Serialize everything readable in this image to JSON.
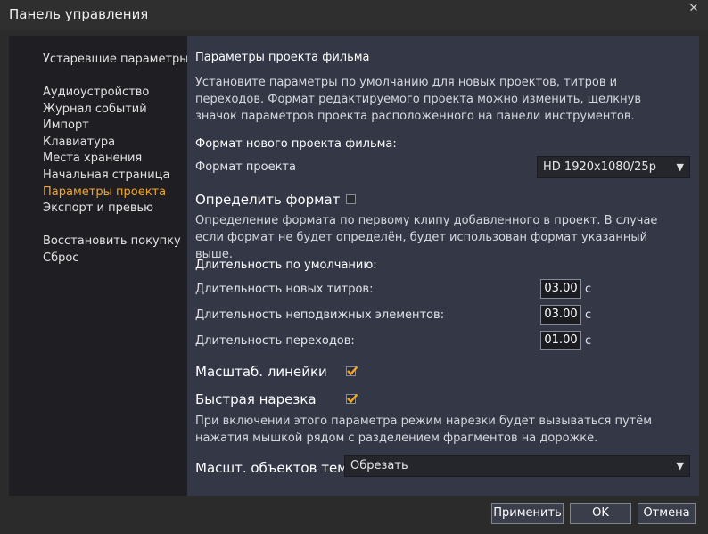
{
  "window": {
    "title": "Панель управления",
    "close_glyph": "✕"
  },
  "sidebar": {
    "items": [
      {
        "label": "Устаревшие параметры",
        "active": false
      },
      {
        "label": "Аудиоустройство",
        "active": false
      },
      {
        "label": "Журнал событий",
        "active": false
      },
      {
        "label": "Импорт",
        "active": false
      },
      {
        "label": "Клавиатура",
        "active": false
      },
      {
        "label": "Места хранения",
        "active": false
      },
      {
        "label": "Начальная страница",
        "active": false
      },
      {
        "label": "Параметры проекта",
        "active": true
      },
      {
        "label": "Экспорт и превью",
        "active": false
      },
      {
        "label": "Восстановить покупку",
        "active": false
      },
      {
        "label": "Сброс",
        "active": false
      }
    ]
  },
  "content": {
    "heading": "Параметры проекта фильма",
    "intro": "Установите параметры по умолчанию для новых проектов, титров и переходов. Формат редактируемого проекта можно изменить, щелкнув значок параметров проекта расположенного на панели инструментов.",
    "new_format_heading": "Формат нового проекта фильма:",
    "format_label": "Формат проекта",
    "format_value": "HD 1920x1080/25p",
    "detect_label": "Определить формат",
    "detect_checked": false,
    "detect_desc": "Определение формата по первому клипу добавленного в проект. В случае если формат не будет определён, будет использован формат указанный выше.",
    "duration_heading": "Длительность по умолчанию:",
    "durations": [
      {
        "label": "Длительность новых титров:",
        "value": "03.00",
        "unit": "с"
      },
      {
        "label": "Длительность неподвижных элементов:",
        "value": "03.00",
        "unit": "с"
      },
      {
        "label": "Длительность переходов:",
        "value": "01.00",
        "unit": "с"
      }
    ],
    "ruler_label": "Масштаб. линейки",
    "ruler_checked": true,
    "fastcut_label": "Быстрая нарезка",
    "fastcut_checked": true,
    "fastcut_desc": "При включении этого параметра режим нарезки будет вызываться путём нажатия мышкой рядом с разделением фрагментов на дорожке.",
    "theme_scale_label": "Масшт. объектов тем",
    "theme_scale_value": "Обрезать",
    "dropdown_glyph": "▼"
  },
  "buttons": {
    "apply": "Применить",
    "ok": "OK",
    "cancel": "Отмена"
  },
  "colors": {
    "accent": "#f5a623",
    "content_bg": "#333746",
    "sidebar_bg": "#1f1f23"
  }
}
